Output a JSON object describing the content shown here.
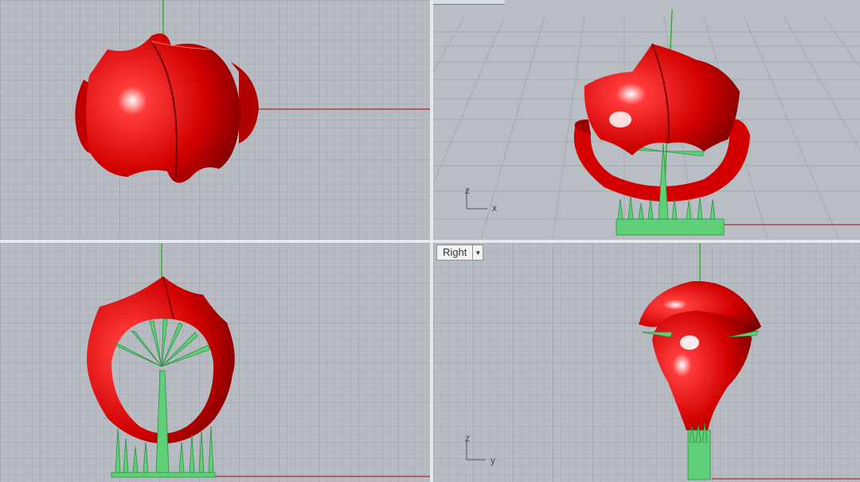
{
  "viewports": {
    "top": {
      "label": ""
    },
    "perspective": {
      "label": ""
    },
    "front": {
      "label": ""
    },
    "right": {
      "label": "Right"
    }
  },
  "axis_indicators": {
    "perspective": {
      "vertical": "z",
      "horizontal": "x"
    },
    "right": {
      "vertical": "z",
      "horizontal": "y"
    }
  },
  "colors": {
    "grid_background": "#b7bcc2",
    "grid_minor": "#a9aeb4",
    "grid_major": "#9aa0a6",
    "model_red": "#e00000",
    "support_green": "#5fcf78",
    "x_axis": "#b04040",
    "y_axis": "#30b030"
  }
}
